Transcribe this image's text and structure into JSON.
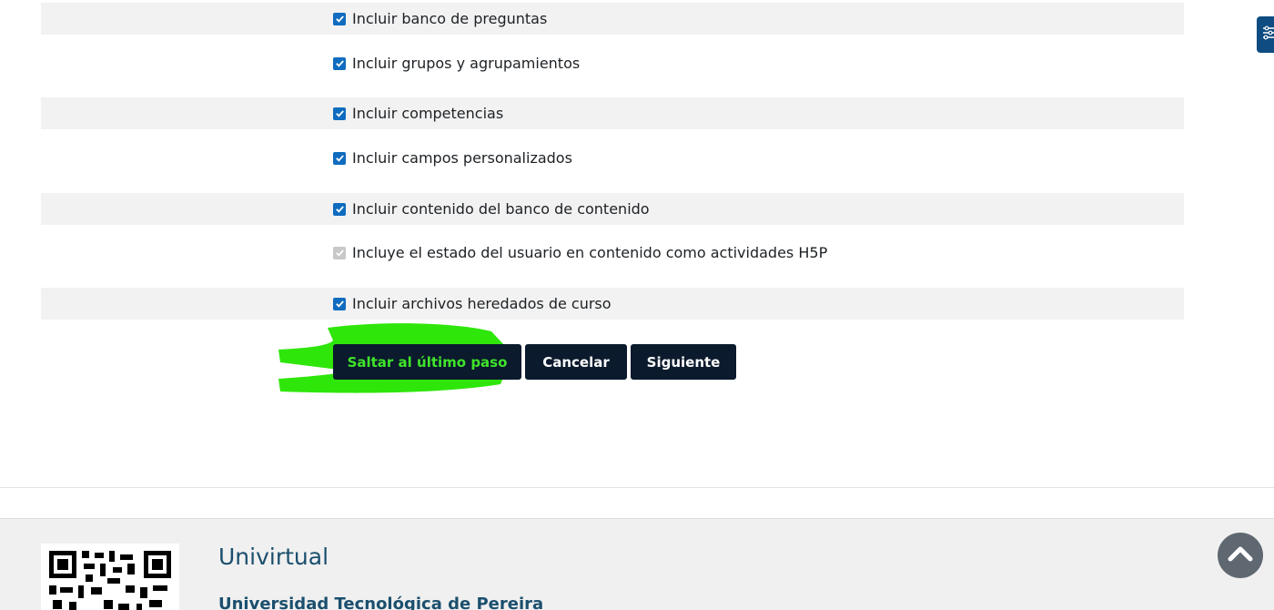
{
  "options": [
    {
      "label": "Incluir banco de preguntas",
      "checked": true,
      "disabled": false
    },
    {
      "label": "Incluir grupos y agrupamientos",
      "checked": true,
      "disabled": false
    },
    {
      "label": "Incluir competencias",
      "checked": true,
      "disabled": false
    },
    {
      "label": "Incluir campos personalizados",
      "checked": true,
      "disabled": false
    },
    {
      "label": "Incluir contenido del banco de contenido",
      "checked": true,
      "disabled": false
    },
    {
      "label": "Incluye el estado del usuario en contenido como actividades H5P",
      "checked": true,
      "disabled": true
    },
    {
      "label": "Incluir archivos heredados de curso",
      "checked": true,
      "disabled": false
    }
  ],
  "buttons": {
    "skip_label": "Saltar al último paso",
    "cancel_label": "Cancelar",
    "next_label": "Siguiente"
  },
  "footer": {
    "title": "Univirtual",
    "subtitle": "Universidad Tecnológica de Pereira"
  },
  "icons": {
    "back_to_top": "chevron-up-icon",
    "side_drawer": "sliders-icon",
    "qr": "qr-code-icon"
  },
  "colors": {
    "accent": "#0f6cbf",
    "button_bg": "#0b1a2c",
    "highlight": "#3fe42a",
    "footer_text": "#1b4f6e"
  }
}
